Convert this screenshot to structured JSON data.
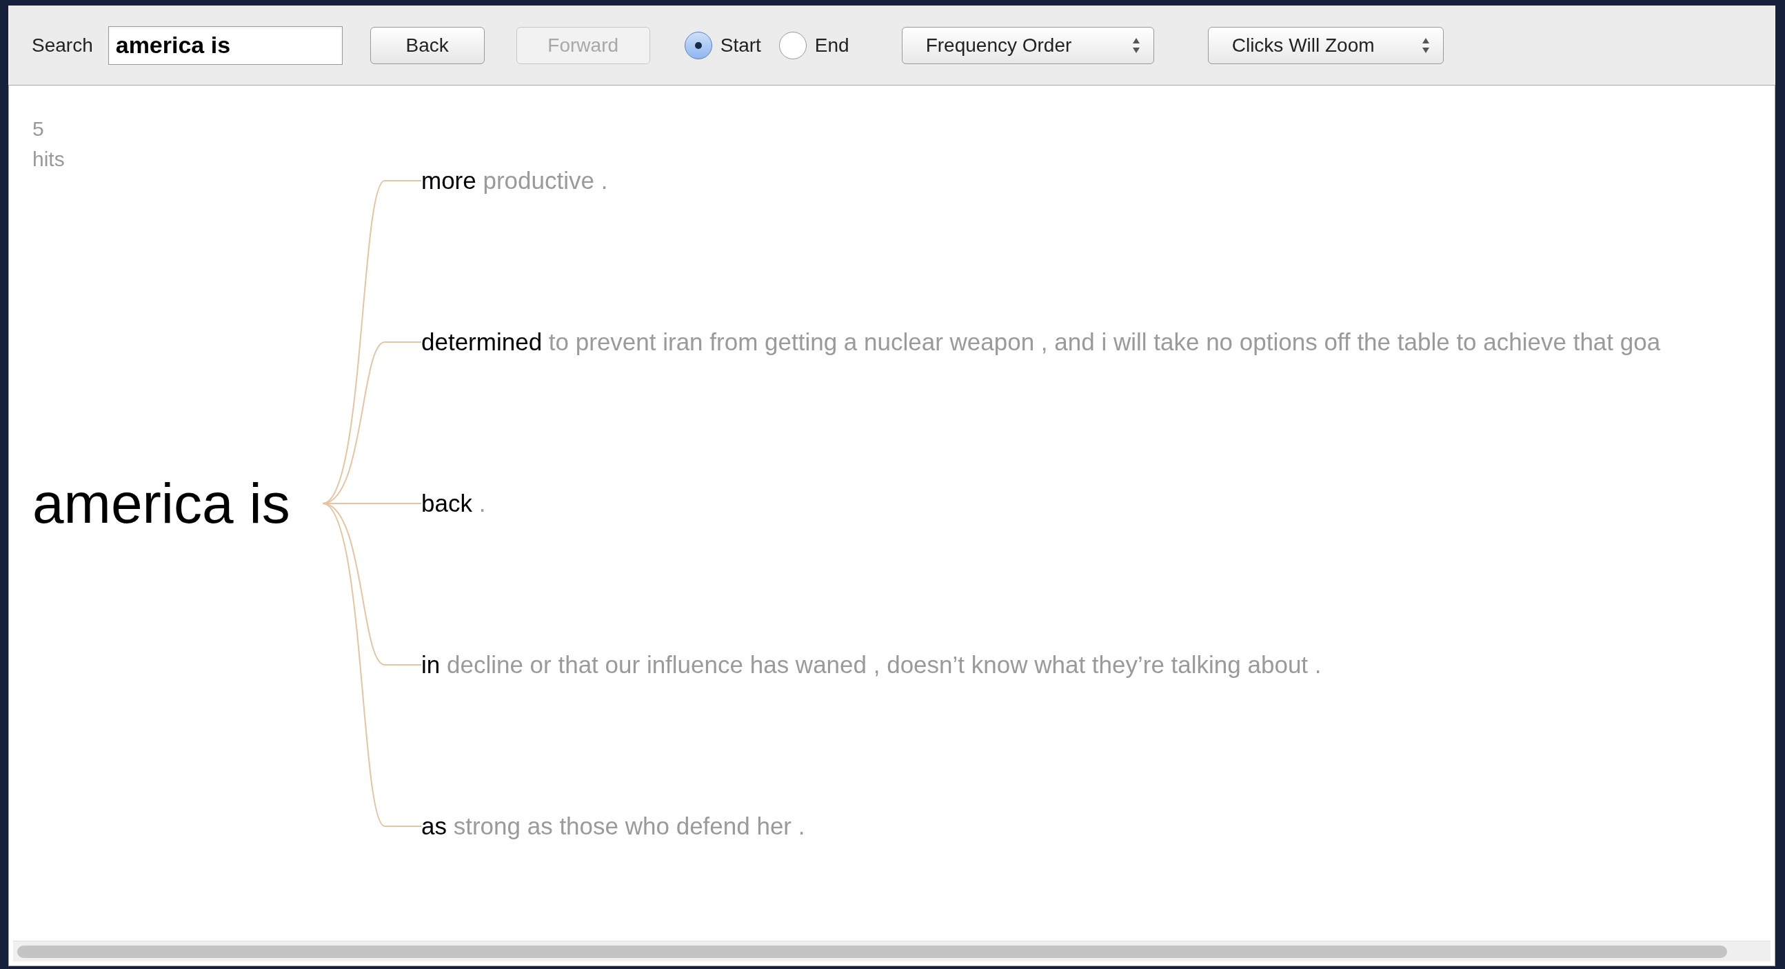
{
  "toolbar": {
    "search_label": "Search",
    "search_value": "america is",
    "buttons": [
      {
        "label": "Back",
        "disabled": false
      },
      {
        "label": "Forward",
        "disabled": true
      }
    ],
    "anchor_options": [
      {
        "label": "Start",
        "selected": true
      },
      {
        "label": "End",
        "selected": false
      }
    ],
    "selects": [
      {
        "value": "Frequency Order"
      },
      {
        "value": "Clicks Will Zoom"
      }
    ]
  },
  "tree": {
    "hit_count": "5",
    "hit_label": "hits",
    "root": "america is",
    "branches": [
      {
        "word": "more",
        "continuation": "productive ."
      },
      {
        "word": "determined",
        "continuation": "to prevent iran from getting a nuclear weapon , and i will take no options off the table to achieve that goa"
      },
      {
        "word": "back",
        "continuation": "."
      },
      {
        "word": "in",
        "continuation": "decline or that our influence has waned , doesn’t know what they’re talking about ."
      },
      {
        "word": "as",
        "continuation": "strong as those who defend her ."
      }
    ]
  }
}
